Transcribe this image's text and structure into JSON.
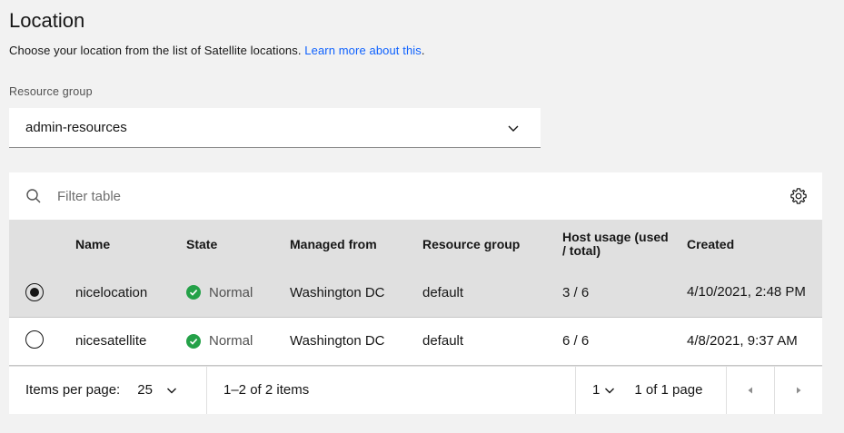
{
  "header": {
    "title": "Location",
    "subtitle": "Choose your location from the list of Satellite locations.",
    "learn_more": "Learn more about this",
    "subtitle_end": "."
  },
  "resource_group": {
    "label": "Resource group",
    "value": "admin-resources"
  },
  "table": {
    "filter_placeholder": "Filter table",
    "columns": {
      "name": "Name",
      "state": "State",
      "managed": "Managed from",
      "rg": "Resource group",
      "host": "Host usage (used / total)",
      "created": "Created"
    },
    "rows": [
      {
        "selected": true,
        "name": "nicelocation",
        "state": "Normal",
        "managed": "Washington DC",
        "rg": "default",
        "host": "3 / 6",
        "created": "4/10/2021, 2:48 PM"
      },
      {
        "selected": false,
        "name": "nicesatellite",
        "state": "Normal",
        "managed": "Washington DC",
        "rg": "default",
        "host": "6 / 6",
        "created": "4/8/2021, 9:37 AM"
      }
    ]
  },
  "pagination": {
    "items_per_page_label": "Items per page:",
    "items_per_page_value": "25",
    "range": "1–2 of 2 items",
    "page_value": "1",
    "page_of": "1 of 1 page"
  },
  "colors": {
    "link": "#0f62fe",
    "success": "#24a148",
    "selected_row": "#e0e0e0"
  }
}
